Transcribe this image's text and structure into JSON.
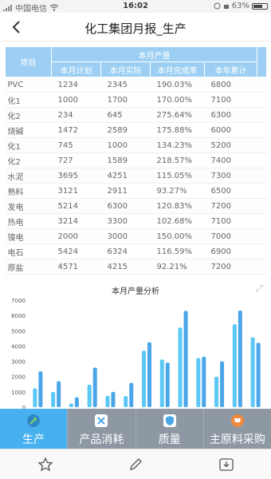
{
  "status_bar": {
    "carrier": "中国电信",
    "time": "16:02",
    "battery": "63%"
  },
  "nav": {
    "title": "化工集团月报_生产"
  },
  "table": {
    "header_item": "项目",
    "header_group": "本月产量",
    "columns": [
      "本月计划",
      "本月实际",
      "本月完成率",
      "本年累计"
    ],
    "rows": [
      {
        "name": "PVC",
        "plan": "1234",
        "actual": "2345",
        "rate": "190.03%",
        "ytd": "6800"
      },
      {
        "name": "化1",
        "plan": "1000",
        "actual": "1700",
        "rate": "170.00%",
        "ytd": "7100"
      },
      {
        "name": "化2",
        "plan": "234",
        "actual": "645",
        "rate": "275.64%",
        "ytd": "6300"
      },
      {
        "name": "烧碱",
        "plan": "1472",
        "actual": "2589",
        "rate": "175.88%",
        "ytd": "6000"
      },
      {
        "name": "化1",
        "plan": "745",
        "actual": "1000",
        "rate": "134.23%",
        "ytd": "5200"
      },
      {
        "name": "化2",
        "plan": "727",
        "actual": "1589",
        "rate": "218.57%",
        "ytd": "7400"
      },
      {
        "name": "水泥",
        "plan": "3695",
        "actual": "4251",
        "rate": "115.05%",
        "ytd": "7300"
      },
      {
        "name": "熟料",
        "plan": "3121",
        "actual": "2911",
        "rate": "93.27%",
        "ytd": "6500"
      },
      {
        "name": "发电",
        "plan": "5214",
        "actual": "6300",
        "rate": "120.83%",
        "ytd": "7200"
      },
      {
        "name": "热电",
        "plan": "3214",
        "actual": "3300",
        "rate": "102.68%",
        "ytd": "7100"
      },
      {
        "name": "镍电",
        "plan": "2000",
        "actual": "3000",
        "rate": "150.00%",
        "ytd": "7000"
      },
      {
        "name": "电石",
        "plan": "5424",
        "actual": "6324",
        "rate": "116.59%",
        "ytd": "6900"
      },
      {
        "name": "原盐",
        "plan": "4571",
        "actual": "4215",
        "rate": "92.21%",
        "ytd": "7200"
      }
    ]
  },
  "chart_data": {
    "type": "bar",
    "title": "本月产量分析",
    "yticks": [
      "7000",
      "6000",
      "5000",
      "4000",
      "3000",
      "2000",
      "1000",
      "0"
    ],
    "ylim": [
      0,
      7000
    ],
    "series": [
      {
        "color": "#5bc8f5",
        "values": [
          1234,
          1000,
          234,
          1472,
          745,
          727,
          3695,
          3121,
          5214,
          3214,
          2000,
          5424,
          4571
        ]
      },
      {
        "color": "#4aa6e8",
        "values": [
          2345,
          1700,
          645,
          2589,
          1000,
          1589,
          4251,
          2911,
          6300,
          3300,
          3000,
          6324,
          4215
        ]
      }
    ]
  },
  "tabs": [
    {
      "label": "生产",
      "icon": "wrench-icon",
      "active": true,
      "icon_color": "#6cbf5a"
    },
    {
      "label": "产品消耗",
      "icon": "flask-icon",
      "active": false,
      "icon_color": "#4aa6e8"
    },
    {
      "label": "质量",
      "icon": "shield-icon",
      "active": false,
      "icon_color": "#4aa6e8"
    },
    {
      "label": "主原料采购",
      "icon": "cart-icon",
      "active": false,
      "icon_color": "#f08a3c"
    }
  ],
  "toolbar": [
    "star-icon",
    "pencil-icon",
    "download-icon"
  ]
}
